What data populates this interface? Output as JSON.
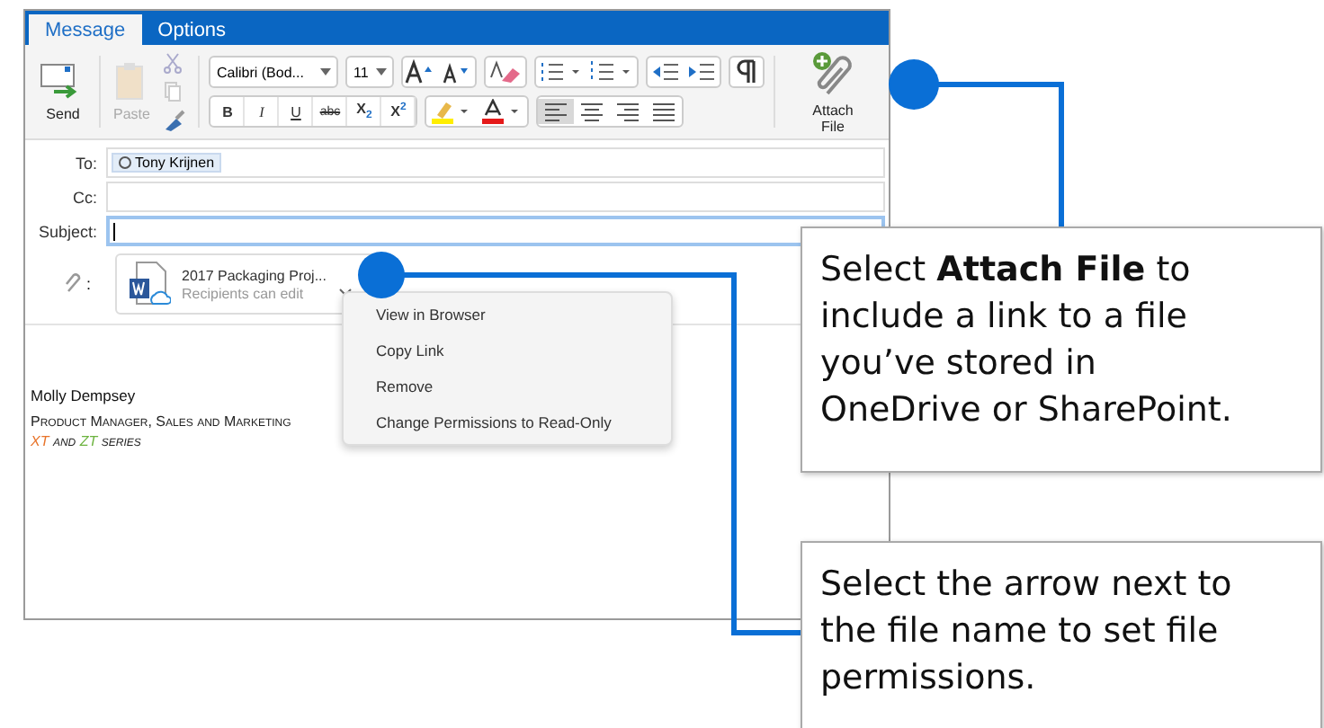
{
  "tabs": [
    {
      "label": "Message",
      "selected": true
    },
    {
      "label": "Options",
      "selected": false
    }
  ],
  "ribbon": {
    "send": "Send",
    "paste": "Paste",
    "font": "Calibri (Bod...",
    "size": "11",
    "format_buttons": [
      "B",
      "I",
      "U",
      "abc",
      "X$_{2}$",
      "X$^{2}$"
    ],
    "attach": "Attach File"
  },
  "fields": [
    {
      "label": "To:",
      "kind": "recipients",
      "value": "Tony Krijnen",
      "focused": false
    },
    {
      "label": "Cc:",
      "kind": "text",
      "focused": false
    },
    {
      "label": "Subject:",
      "kind": "text",
      "focused": true
    }
  ],
  "attachment": {
    "label": ":",
    "name": "2017 Packaging Proj...",
    "note": "Recipients can edit"
  },
  "menu": [
    "View in Browser",
    "Copy Link",
    "Remove",
    "Change Permissions to Read-Only"
  ],
  "signature": {
    "name": "Molly Dempsey",
    "title": "Product Manager, Sales and Marketing",
    "series": [
      {
        "text": "XT",
        "color": "#e8742a"
      },
      {
        "text": "and",
        "color": "#222222"
      },
      {
        "text": "ZT",
        "color": "#6cb33f"
      },
      {
        "text": "series",
        "color": "#222222"
      }
    ]
  },
  "callouts": [
    {
      "text": "Select **Attach File** to include a link to a file you’ve stored in OneDrive or SharePoint."
    },
    {
      "text": "Select the arrow next to the file name to set file permissions."
    }
  ]
}
